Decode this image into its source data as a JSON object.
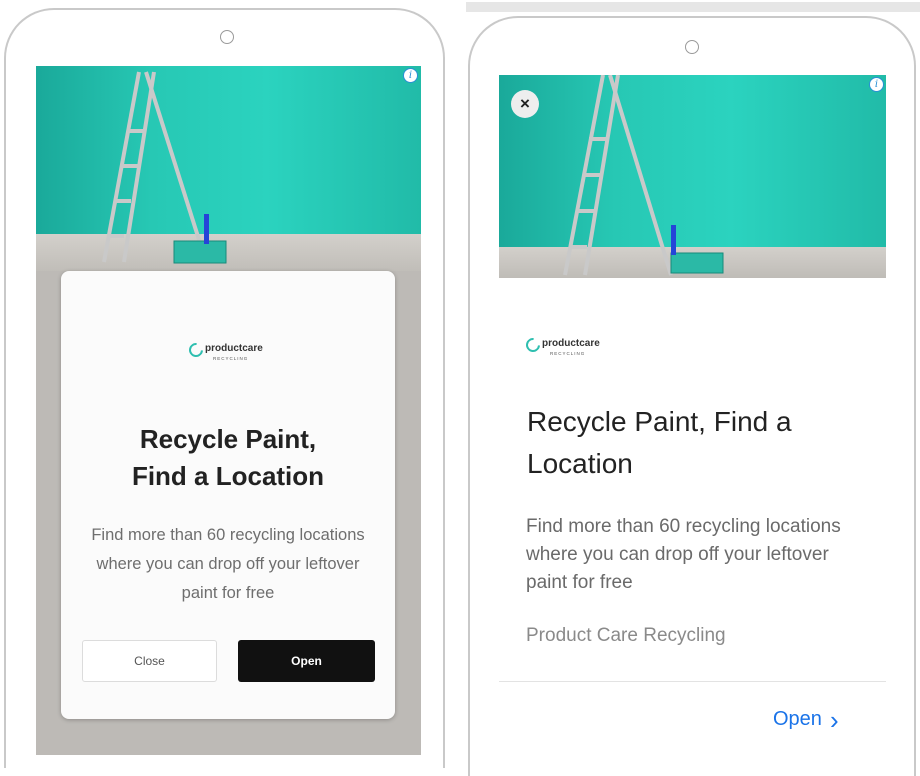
{
  "left_ad": {
    "info_glyph": "i",
    "logo": {
      "brand": "productcare",
      "sub": "RECYCLING"
    },
    "title": "Recycle Paint,\nFind a Location",
    "description": "Find more than 60 recycling locations where you can drop off your leftover paint for free",
    "close_label": "Close",
    "open_label": "Open"
  },
  "right_ad": {
    "close_glyph": "×",
    "info_glyph": "i",
    "logo": {
      "brand": "productcare",
      "sub": "RECYCLING"
    },
    "title": "Recycle Paint, Find a Location",
    "description": "Find more than 60 recycling locations where you can drop off your leftover paint for free",
    "advertiser": "Product Care Recycling",
    "open_label": "Open",
    "open_chevron": "›"
  },
  "colors": {
    "accent_teal": "#27c8b4",
    "open_link": "#1a73e8",
    "open_button": "#111111"
  },
  "icons": [
    "info-icon",
    "close-icon",
    "chevron-right-icon",
    "productcare-logo"
  ]
}
